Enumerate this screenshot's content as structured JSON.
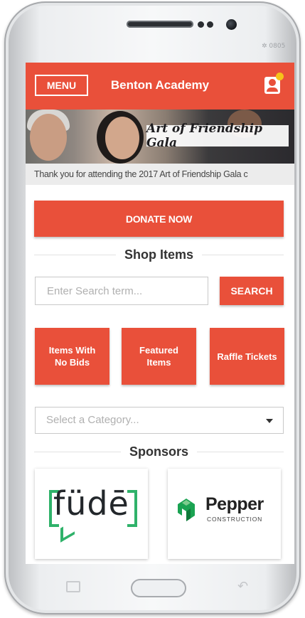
{
  "device": {
    "brand_text": "✲ 0805"
  },
  "header": {
    "menu_label": "MENU",
    "title": "Benton Academy",
    "accent_color": "#e9503a",
    "notification_dot_color": "#f6c21a"
  },
  "banner": {
    "title": "Art of Friendship Gala",
    "caption": "Thank you for attending the 2017 Art of Friendship Gala c"
  },
  "donate": {
    "label": "DONATE NOW"
  },
  "shop": {
    "heading": "Shop Items",
    "search_placeholder": "Enter Search term...",
    "search_button": "SEARCH",
    "tiles": [
      {
        "label": "Items With No Bids"
      },
      {
        "label": "Featured Items"
      },
      {
        "label": "Raffle Tickets"
      }
    ],
    "category_placeholder": "Select a Category..."
  },
  "sponsors": {
    "heading": "Sponsors",
    "items": [
      {
        "name": "füdē"
      },
      {
        "name": "Pepper",
        "subtitle": "CONSTRUCTION"
      }
    ]
  }
}
